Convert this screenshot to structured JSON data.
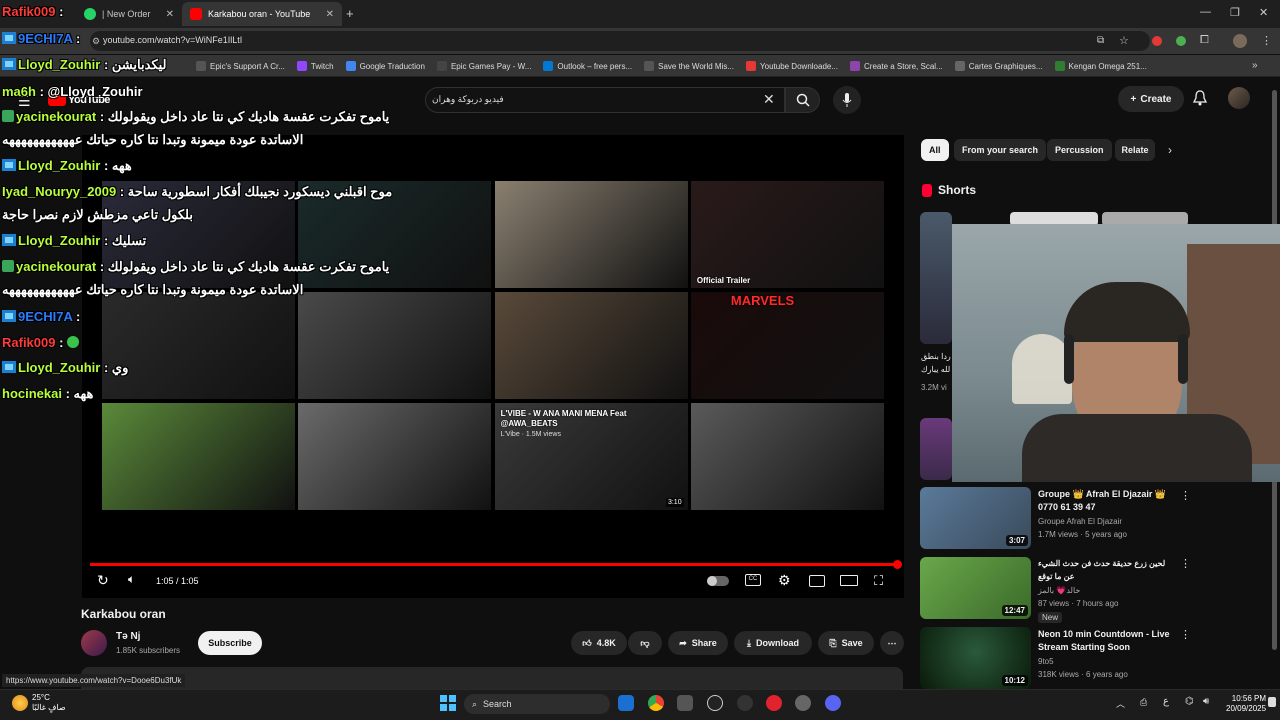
{
  "browser": {
    "tabs": [
      {
        "label": "| New Order",
        "active": false
      },
      {
        "label": "Karkabou oran - YouTube",
        "active": true
      }
    ],
    "url": "youtube.com/watch?v=WiNFe1IlLtI",
    "status_link": "https://www.youtube.com/watch?v=Dooe6Du3fUk",
    "bookmarks": [
      "Epic's Support A Cr...",
      "Twitch",
      "Google Traduction",
      "Epic Games Pay - W...",
      "Outlook – free pers...",
      "Save the World Mis...",
      "Youtube Downloade...",
      "Create a Store, Scal...",
      "Cartes Graphiques...",
      "Kengan Omega 251..."
    ],
    "bookmark_colors": [
      "#555555",
      "#9146ff",
      "#4285f4",
      "#444444",
      "#0078d4",
      "#555555",
      "#e53935",
      "#8e44ad",
      "#666666",
      "#2e7d32"
    ]
  },
  "youtube": {
    "logo_text": "YouTube",
    "search_query": "فيديو دربوكة وهران",
    "create_label": "Create",
    "video": {
      "title": "Karkabou oran",
      "time": "1:05 / 1:05",
      "progress_fraction": 1.0,
      "channel": "Tə Nj",
      "subscribers": "1.85K subscribers",
      "subscribe_label": "Subscribe",
      "likes": "4.8K",
      "share_label": "Share",
      "download_label": "Download",
      "save_label": "Save"
    },
    "endscreen": [
      {
        "title": "",
        "meta": "",
        "duration": "",
        "color": "#2a2a3a"
      },
      {
        "title": "",
        "meta": "",
        "duration": "",
        "color": "#1a2a2a"
      },
      {
        "title": "",
        "meta": "",
        "duration": "",
        "color": "#8a8070"
      },
      {
        "title": "Official Trailer",
        "meta": "",
        "duration": "",
        "color": "#2a1a1a"
      },
      {
        "title": "",
        "meta": "",
        "duration": "",
        "color": "#2a2a2a"
      },
      {
        "title": "",
        "meta": "",
        "duration": "",
        "color": "#4a4a4a"
      },
      {
        "title": "",
        "meta": "",
        "duration": "",
        "color": "#5a4a3a"
      },
      {
        "title": "MARVELS",
        "meta": "",
        "duration": "",
        "color": "#1a0a0a"
      },
      {
        "title": "",
        "meta": "",
        "duration": "",
        "color": "#5a8a3a"
      },
      {
        "title": "",
        "meta": "",
        "duration": "",
        "color": "#6a6a6a"
      },
      {
        "title": "L'VIBE - W ANA MANI MENA Feat @AWA_BEATS",
        "meta": "L'Vibe · 1.5M views",
        "duration": "3:10",
        "color": "#3a3a3a"
      },
      {
        "title": "",
        "meta": "",
        "duration": "",
        "color": "#5a5a5a"
      }
    ],
    "chips": [
      "All",
      "From your search",
      "Percussion",
      "Relate"
    ],
    "shorts_header": "Shorts",
    "shorts_snippets": [
      "ردا بنطق",
      "لله يبارك",
      "3.2M vi"
    ],
    "recommendations": [
      {
        "title": "Groupe 👑 Afrah El Djazair 👑 0770 61 39 47",
        "channel": "Groupe Afrah El Djazair",
        "meta": "1.7M views · 5 years ago",
        "duration": "3:07",
        "badge": ""
      },
      {
        "title": "لحين زرع حديقة حدث فن حدث الشيء عن ما توقع",
        "channel": "خالد💗 بالمز",
        "meta": "87 views · 7 hours ago",
        "duration": "12:47",
        "badge": "New"
      },
      {
        "title": "Neon 10 min Countdown - Live Stream Starting Soon",
        "channel": "9to5",
        "meta": "318K views · 6 years ago",
        "duration": "10:12",
        "badge": ""
      }
    ]
  },
  "chat": [
    {
      "user": "Rafik009",
      "msg": "",
      "color": "#ff3b3b"
    },
    {
      "user": "9ECHI7A",
      "msg": "",
      "color": "#2a7cff"
    },
    {
      "user": "Lloyd_Zouhir",
      "msg": "ليكدبايشن",
      "color": "#b8ff3b"
    },
    {
      "user": "ma6h",
      "msg": "@Lloyd_Zouhir",
      "color": "#b8ff3b"
    },
    {
      "user": "yacinekourat",
      "msg": "ياموح تفكرت عقسة هاديك كي نتا عاد داخل ويقولولك",
      "color": "#b8ff3b"
    },
    {
      "user": "",
      "msg": "الاساتدة عودة ميمونة وتبدا نتا كاره حياتك عهههههههههههه",
      "color": "#ffffff"
    },
    {
      "user": "Lloyd_Zouhir",
      "msg": "ههه",
      "color": "#b8ff3b"
    },
    {
      "user": "Iyad_Nouryy_2009",
      "msg": "موح اقبلني ديسكورد نجيبلك أفكار اسطورية ساحة",
      "color": "#b8ff3b"
    },
    {
      "user": "",
      "msg": "بلكول تاعي مزطش لازم نصرا حاجة",
      "color": "#ffffff"
    },
    {
      "user": "Lloyd_Zouhir",
      "msg": "تسليك",
      "color": "#b8ff3b"
    },
    {
      "user": "yacinekourat",
      "msg": "ياموح تفكرت عقسة هاديك كي نتا عاد داخل ويقولولك",
      "color": "#b8ff3b"
    },
    {
      "user": "",
      "msg": "الاساتدة عودة ميمونة وتبدا نتا كاره حياتك عهههههههههههه",
      "color": "#ffffff"
    },
    {
      "user": "9ECHI7A",
      "msg": "",
      "color": "#2a7cff"
    },
    {
      "user": "Rafik009",
      "msg": "",
      "color": "#ff3b3b"
    },
    {
      "user": "Lloyd_Zouhir",
      "msg": "وي",
      "color": "#b8ff3b"
    },
    {
      "user": "hocinekai",
      "msg": "ههه",
      "color": "#b8ff3b"
    }
  ],
  "taskbar": {
    "temp": "25°C",
    "weather_desc": "صافٍ غالبًا",
    "search_label": "Search",
    "time": "10:56 PM",
    "date": "20/09/2025",
    "lang": "ع"
  }
}
